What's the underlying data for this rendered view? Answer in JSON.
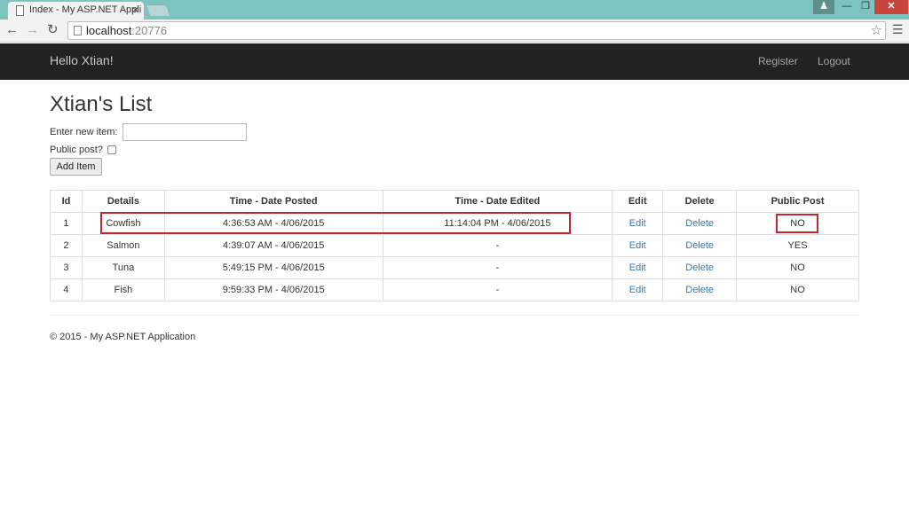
{
  "browser": {
    "tab_title": "Index - My ASP.NET Appli",
    "tab_close": "×",
    "url_host": "localhost",
    "url_port": ":20776",
    "icons": [
      "back-arrow-icon",
      "forward-arrow-icon",
      "reload-icon",
      "star-icon",
      "menu-icon",
      "user-icon",
      "minimize-icon",
      "maximize-icon",
      "close-icon"
    ]
  },
  "navbar": {
    "brand": "Hello Xtian!",
    "register": "Register",
    "logout": "Logout"
  },
  "page": {
    "title": "Xtian's List",
    "new_item_label": "Enter new item:",
    "public_label": "Public post?",
    "add_button": "Add Item"
  },
  "table": {
    "headers": [
      "Id",
      "Details",
      "Time - Date Posted",
      "Time - Date Edited",
      "Edit",
      "Delete",
      "Public Post"
    ],
    "rows": [
      {
        "id": "1",
        "details": "Cowfish",
        "posted": "4:36:53 AM - 4/06/2015",
        "edited": "11:14:04 PM - 4/06/2015",
        "edit": "Edit",
        "delete": "Delete",
        "public": "NO"
      },
      {
        "id": "2",
        "details": "Salmon",
        "posted": "4:39:07 AM - 4/06/2015",
        "edited": "-",
        "edit": "Edit",
        "delete": "Delete",
        "public": "YES"
      },
      {
        "id": "3",
        "details": "Tuna",
        "posted": "5:49:15 PM - 4/06/2015",
        "edited": "-",
        "edit": "Edit",
        "delete": "Delete",
        "public": "NO"
      },
      {
        "id": "4",
        "details": "Fish",
        "posted": "9:59:33 PM - 4/06/2015",
        "edited": "-",
        "edit": "Edit",
        "delete": "Delete",
        "public": "NO"
      }
    ]
  },
  "footer": {
    "text": "© 2015 - My ASP.NET Application"
  },
  "colors": {
    "link": "#337ab7",
    "navbar": "#222222",
    "highlight": "#c0282d"
  }
}
